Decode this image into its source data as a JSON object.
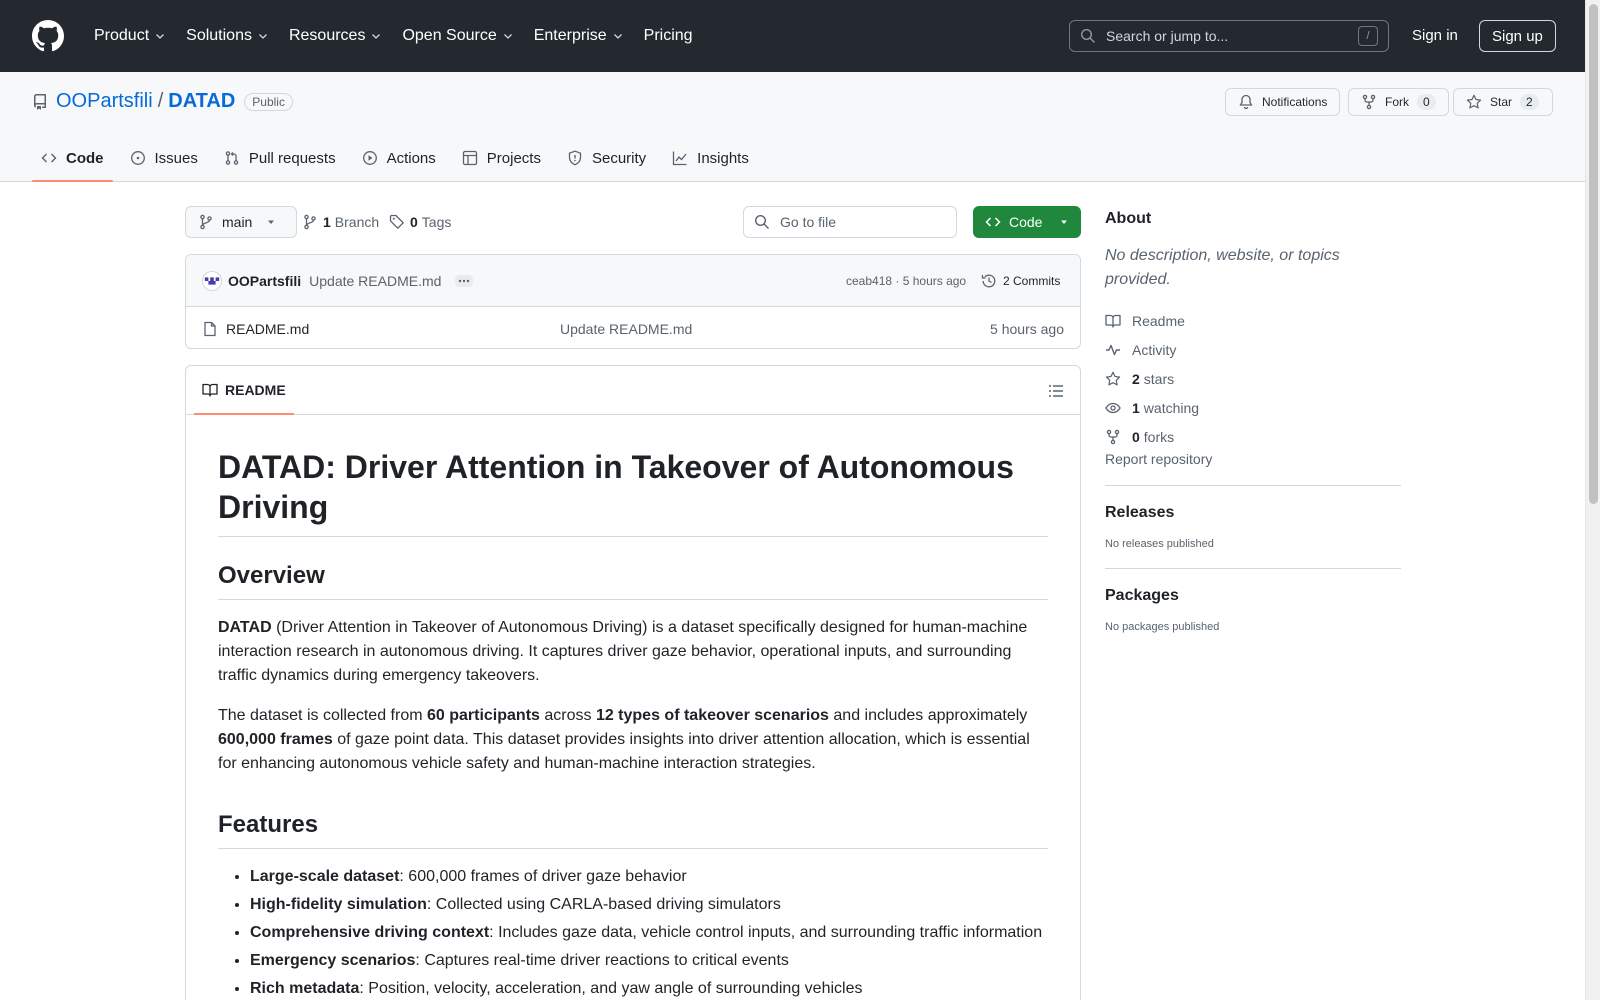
{
  "header": {
    "nav": [
      {
        "label": "Product",
        "dropdown": true
      },
      {
        "label": "Solutions",
        "dropdown": true
      },
      {
        "label": "Resources",
        "dropdown": true
      },
      {
        "label": "Open Source",
        "dropdown": true
      },
      {
        "label": "Enterprise",
        "dropdown": true
      },
      {
        "label": "Pricing",
        "dropdown": false
      }
    ],
    "search_placeholder": "Search or jump to...",
    "search_shortcut": "/",
    "signin": "Sign in",
    "signup": "Sign up"
  },
  "repo": {
    "owner": "OOPartsfili",
    "separator": "/",
    "name": "DATAD",
    "visibility": "Public",
    "notifications_label": "Notifications",
    "fork_label": "Fork",
    "fork_count": "0",
    "star_label": "Star",
    "star_count": "2",
    "tabs": [
      "Code",
      "Issues",
      "Pull requests",
      "Actions",
      "Projects",
      "Security",
      "Insights"
    ]
  },
  "toolbar": {
    "branch": "main",
    "branch_count": "1",
    "branch_label": "Branch",
    "tag_count": "0",
    "tag_label": "Tags",
    "goto_placeholder": "Go to file",
    "code_button": "Code"
  },
  "latest_commit": {
    "author": "OOPartsfili",
    "message": "Update README.md",
    "hash_time": "ceab418 · 5 hours ago",
    "commits": "2 Commits"
  },
  "files": [
    {
      "name": "README.md",
      "message": "Update README.md",
      "time": "5 hours ago"
    }
  ],
  "readme": {
    "tab_label": "README",
    "title": "DATAD: Driver Attention in Takeover of Autonomous Driving",
    "overview_heading": "Overview",
    "p1_bold": "DATAD",
    "p1_rest": " (Driver Attention in Takeover of Autonomous Driving) is a dataset specifically designed for human-machine interaction research in autonomous driving. It captures driver gaze behavior, operational inputs, and surrounding traffic dynamics during emergency takeovers.",
    "p2_a": "The dataset is collected from ",
    "p2_b": "60 participants",
    "p2_c": " across ",
    "p2_d": "12 types of takeover scenarios",
    "p2_e": " and includes approximately ",
    "p2_f": "600,000 frames",
    "p2_g": " of gaze point data. This dataset provides insights into driver attention allocation, which is essential for enhancing autonomous vehicle safety and human-machine interaction strategies.",
    "features_heading": "Features",
    "features": [
      {
        "bold": "Large-scale dataset",
        "text": ": 600,000 frames of driver gaze behavior"
      },
      {
        "bold": "High-fidelity simulation",
        "text": ": Collected using CARLA-based driving simulators"
      },
      {
        "bold": "Comprehensive driving context",
        "text": ": Includes gaze data, vehicle control inputs, and surrounding traffic information"
      },
      {
        "bold": "Emergency scenarios",
        "text": ": Captures real-time driver reactions to critical events"
      },
      {
        "bold": "Rich metadata",
        "text": ": Position, velocity, acceleration, and yaw angle of surrounding vehicles"
      }
    ]
  },
  "sidebar": {
    "about_heading": "About",
    "about_text": "No description, website, or topics provided.",
    "readme_link": "Readme",
    "activity_link": "Activity",
    "stars_count": "2",
    "stars_label": "stars",
    "watching_count": "1",
    "watching_label": "watching",
    "forks_count": "0",
    "forks_label": "forks",
    "report": "Report repository",
    "releases_heading": "Releases",
    "releases_text": "No releases published",
    "packages_heading": "Packages",
    "packages_text": "No packages published"
  }
}
